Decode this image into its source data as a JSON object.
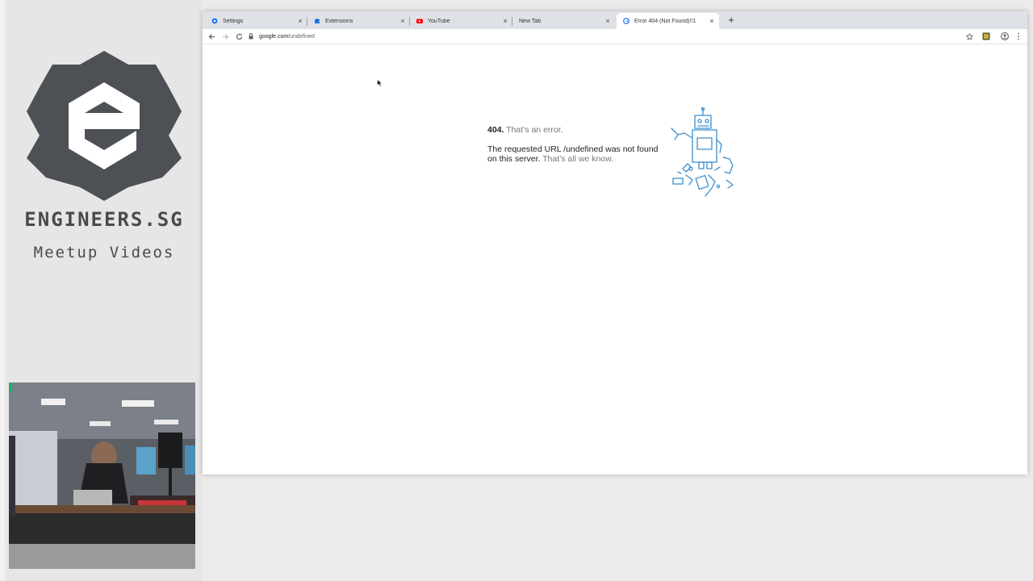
{
  "branding": {
    "title": "ENGINEERS.SG",
    "subtitle": "Meetup Videos",
    "logo_letter": "e"
  },
  "browser": {
    "tabs": [
      {
        "label": "Settings",
        "icon": "gear-icon"
      },
      {
        "label": "Extensions",
        "icon": "puzzle-icon"
      },
      {
        "label": "YouTube",
        "icon": "youtube-icon"
      },
      {
        "label": "New Tab",
        "icon": ""
      },
      {
        "label": "Error 404 (Not Found)!!1",
        "icon": "google-icon",
        "active": true
      }
    ],
    "new_tab_label": "+",
    "close_glyph": "×",
    "url": {
      "host": "google.com",
      "path": "/undefined"
    }
  },
  "page": {
    "code": "404.",
    "headline": "That’s an error.",
    "message": "The requested URL /undefined was not found on this server.",
    "tail": "That’s all we know."
  },
  "colors": {
    "accent": "#1a73e8",
    "youtube": "#ff0000",
    "robot_stroke": "#3a8fd0",
    "logo_hex": "#4d5054"
  }
}
